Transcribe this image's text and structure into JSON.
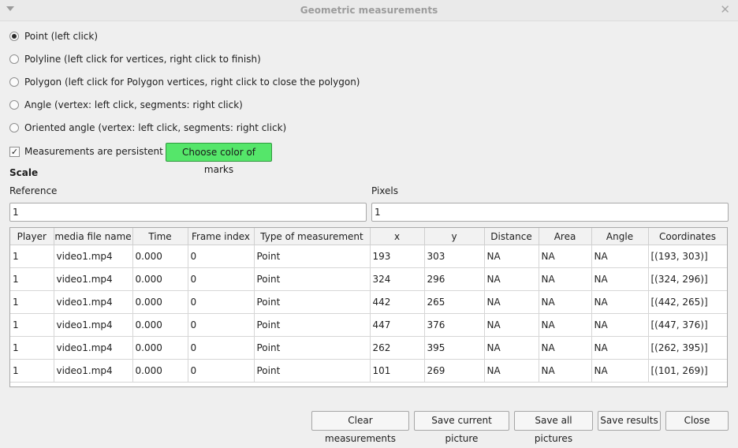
{
  "window": {
    "title": "Geometric measurements"
  },
  "modes": [
    {
      "label": "Point (left click)",
      "selected": true
    },
    {
      "label": "Polyline (left click for vertices, right click to finish)",
      "selected": false
    },
    {
      "label": "Polygon (left click for Polygon vertices, right click to close the polygon)",
      "selected": false
    },
    {
      "label": "Angle (vertex: left click, segments: right click)",
      "selected": false
    },
    {
      "label": "Oriented angle (vertex: left click, segments: right click)",
      "selected": false
    }
  ],
  "persistent": {
    "label": "Measurements are persistent",
    "checked": true,
    "check_glyph": "✓"
  },
  "color_button": {
    "label": "Choose color of marks",
    "color": "#55e66a"
  },
  "scale": {
    "heading": "Scale",
    "reference_label": "Reference",
    "reference_value": "1",
    "pixels_label": "Pixels",
    "pixels_value": "1"
  },
  "table": {
    "columns": [
      "Player",
      "media file name",
      "Time",
      "Frame index",
      "Type of measurement",
      "x",
      "y",
      "Distance",
      "Area",
      "Angle",
      "Coordinates"
    ],
    "rows": [
      [
        "1",
        "video1.mp4",
        "0.000",
        "0",
        "Point",
        "193",
        "303",
        "NA",
        "NA",
        "NA",
        "[(193, 303)]"
      ],
      [
        "1",
        "video1.mp4",
        "0.000",
        "0",
        "Point",
        "324",
        "296",
        "NA",
        "NA",
        "NA",
        "[(324, 296)]"
      ],
      [
        "1",
        "video1.mp4",
        "0.000",
        "0",
        "Point",
        "442",
        "265",
        "NA",
        "NA",
        "NA",
        "[(442, 265)]"
      ],
      [
        "1",
        "video1.mp4",
        "0.000",
        "0",
        "Point",
        "447",
        "376",
        "NA",
        "NA",
        "NA",
        "[(447, 376)]"
      ],
      [
        "1",
        "video1.mp4",
        "0.000",
        "0",
        "Point",
        "262",
        "395",
        "NA",
        "NA",
        "NA",
        "[(262, 395)]"
      ],
      [
        "1",
        "video1.mp4",
        "0.000",
        "0",
        "Point",
        "101",
        "269",
        "NA",
        "NA",
        "NA",
        "[(101, 269)]"
      ]
    ]
  },
  "buttons": {
    "clear": "Clear measurements",
    "save_current": "Save current picture",
    "save_all": "Save all pictures",
    "save_results": "Save results",
    "close": "Close"
  },
  "icons": {
    "window_menu": "window-menu-icon",
    "window_close": "window-close-icon",
    "close_glyph": "✕"
  }
}
